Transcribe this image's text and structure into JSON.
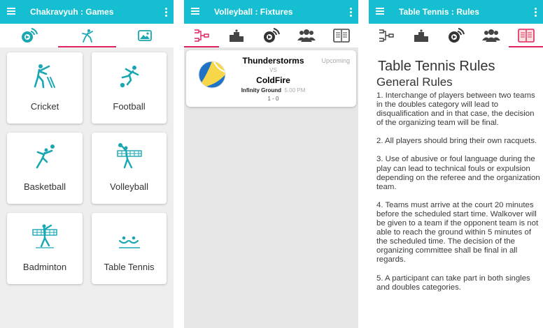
{
  "colors": {
    "appbar": "#15bfd1",
    "accent": "#e0245e",
    "teal": "#1aa7b3",
    "dark": "#333333"
  },
  "screen1": {
    "title": "Chakravyuh : Games",
    "tabs": [
      {
        "icon": "live-score-icon",
        "active": false
      },
      {
        "icon": "player-icon",
        "active": true
      },
      {
        "icon": "gallery-icon",
        "active": false
      }
    ],
    "cards": [
      {
        "label": "Cricket",
        "icon": "cricket-icon"
      },
      {
        "label": "Football",
        "icon": "football-icon"
      },
      {
        "label": "Basketball",
        "icon": "basketball-icon"
      },
      {
        "label": "Volleyball",
        "icon": "volleyball-icon"
      },
      {
        "label": "Badminton",
        "icon": "badminton-icon"
      },
      {
        "label": "Table Tennis",
        "icon": "table-tennis-icon"
      }
    ]
  },
  "screen2": {
    "title": "Volleyball : Fixtures",
    "tabs": [
      {
        "icon": "fixtures-bracket-icon",
        "active": true
      },
      {
        "icon": "podium-icon",
        "active": false
      },
      {
        "icon": "live-score-icon",
        "active": false
      },
      {
        "icon": "teams-icon",
        "active": false
      },
      {
        "icon": "rules-book-icon",
        "active": false
      }
    ],
    "fixture": {
      "team1": "Thunderstorms",
      "vs": "VS",
      "team2": "ColdFire",
      "venue": "Infinity Ground",
      "time": "5.00 PM",
      "score": "1 - 0",
      "status": "Upcoming"
    }
  },
  "screen3": {
    "title": "Table Tennis : Rules",
    "tabs": [
      {
        "icon": "fixtures-bracket-icon",
        "active": false
      },
      {
        "icon": "podium-icon",
        "active": false
      },
      {
        "icon": "live-score-icon",
        "active": false
      },
      {
        "icon": "teams-icon",
        "active": false
      },
      {
        "icon": "rules-book-icon",
        "active": true
      }
    ],
    "heading": "Table Tennis Rules",
    "subheading": "General Rules",
    "rules": [
      "1. Interchange of players between two teams in the doubles category will lead to disqualification and in that case, the decision of the organizing team will be final.",
      " 2. All players should bring their own racquets.",
      " 3. Use of abusive or foul language during the play can lead to technical fouls or expulsion depending on the referee and the organization team.",
      " 4. Teams must arrive at the court 20 minutes before the scheduled start time. Walkover will be given to a team if the opponent team is not able to reach the ground within 5 minutes of the scheduled time. The decision of the organizing committee shall be final in all regards.",
      " 5. A participant can take part in both singles and doubles categories."
    ]
  }
}
